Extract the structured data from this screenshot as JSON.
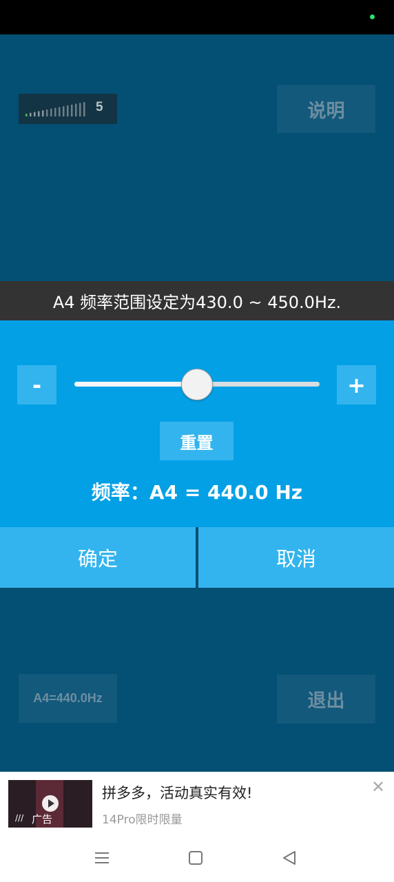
{
  "status_bar": {
    "indicator_color": "#2ee26a"
  },
  "toolbar": {
    "volume_level": 5,
    "volume_max": 15,
    "volume_label": "5",
    "help_label": "说明",
    "a4_label": "A4=440.0Hz",
    "exit_label": "退出"
  },
  "dialog": {
    "title": "A4 频率范围设定为430.0 ~ 450.0Hz.",
    "minus_label": "-",
    "plus_label": "+",
    "slider": {
      "min": 430.0,
      "max": 450.0,
      "value": 440.0
    },
    "reset_label": "重置",
    "frequency_text": "频率：A4 = 440.0 Hz",
    "ok_label": "确定",
    "cancel_label": "取消"
  },
  "ad": {
    "title": "拼多多，活动真实有效!",
    "subtitle": "14Pro限时限量",
    "tag": "广告",
    "close_icon": "close-icon",
    "thumbnail_icon": "play-icon"
  },
  "nav": {
    "icons": [
      "menu-icon",
      "home-square-icon",
      "back-triangle-icon"
    ]
  },
  "colors": {
    "background": "#044f74",
    "dialog_title_bg": "#333333",
    "dialog_body_bg": "#03a0e6",
    "dialog_button_bg": "#33b4ee",
    "dimmed_button_bg": "#13597c"
  }
}
